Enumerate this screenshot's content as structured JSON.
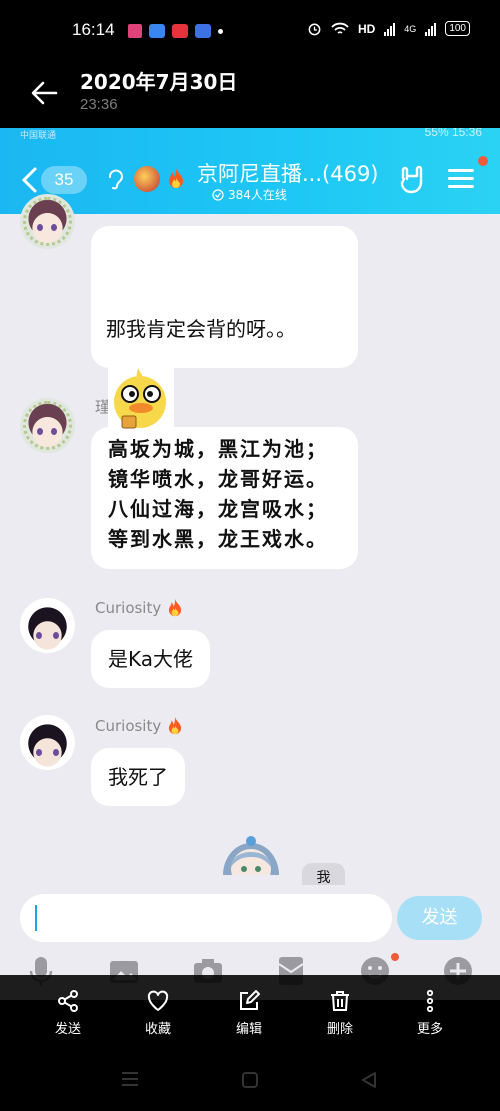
{
  "status_bar": {
    "time": "16:14",
    "network": "HD",
    "signal_label": "4G",
    "battery": "100"
  },
  "viewer": {
    "date": "2020年7月30日",
    "time": "23:36",
    "actions": [
      {
        "label": "发送",
        "icon": "share-icon"
      },
      {
        "label": "收藏",
        "icon": "heart-icon"
      },
      {
        "label": "编辑",
        "icon": "edit-icon"
      },
      {
        "label": "删除",
        "icon": "trash-icon"
      },
      {
        "label": "更多",
        "icon": "more-icon"
      }
    ]
  },
  "qq": {
    "status_left": "中国联通",
    "status_right": "55%  15:36",
    "unread_badge": "35",
    "group_title": "京阿尼直播...(469)",
    "online": "384人在线",
    "messages": [
      {
        "sender": "",
        "text": "那我肯定会背的呀。。",
        "has_sticker": true
      },
      {
        "sender": "瑾瑾辣",
        "lines": [
          "高坂为城，黑江为池；",
          "镜华喷水，龙哥好运。",
          "八仙过海，龙宫吸水；",
          "等到水黑，龙王戏水。"
        ]
      },
      {
        "sender": "Curiosity",
        "text": "是Ka大佬"
      },
      {
        "sender": "Curiosity",
        "text": "我死了"
      }
    ],
    "me_tag": "我",
    "input_placeholder": "",
    "send_label": "发送",
    "accent": "#1ec8f5"
  }
}
